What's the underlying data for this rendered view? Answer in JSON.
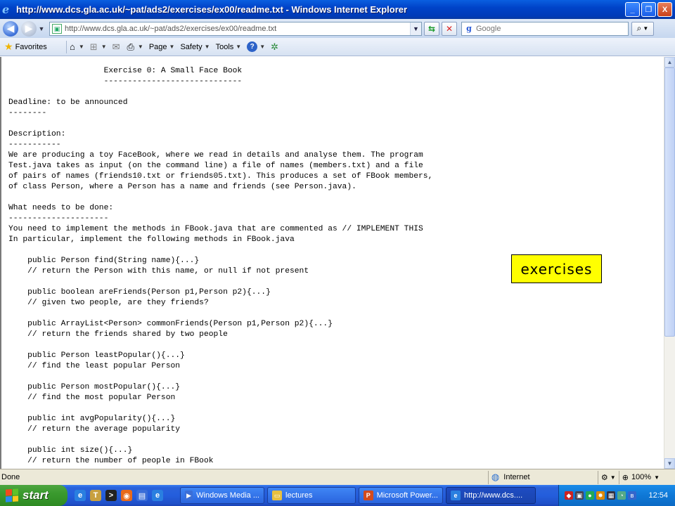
{
  "window": {
    "title": "http://www.dcs.gla.ac.uk/~pat/ads2/exercises/ex00/readme.txt - Windows Internet Explorer",
    "minimize": "_",
    "maximize": "❐",
    "close": "X"
  },
  "address_bar": {
    "url": "http://www.dcs.gla.ac.uk/~pat/ads2/exercises/ex00/readme.txt",
    "search_placeholder": "Google"
  },
  "command_bar": {
    "favorites": "Favorites",
    "page": "Page",
    "safety": "Safety",
    "tools": "Tools"
  },
  "document": {
    "lines": [
      "                    Exercise 0: A Small Face Book",
      "                    -----------------------------",
      "",
      "Deadline: to be announced",
      "--------",
      "",
      "Description:",
      "-----------",
      "We are producing a toy FaceBook, where we read in details and analyse them. The program",
      "Test.java takes as input (on the command line) a file of names (members.txt) and a file",
      "of pairs of names (friends10.txt or friends05.txt). This produces a set of FBook members,",
      "of class Person, where a Person has a name and friends (see Person.java).",
      "",
      "What needs to be done:",
      "---------------------",
      "You need to implement the methods in FBook.java that are commented as // IMPLEMENT THIS",
      "In particular, implement the following methods in FBook.java",
      "",
      "    public Person find(String name){...}",
      "    // return the Person with this name, or null if not present",
      "",
      "    public boolean areFriends(Person p1,Person p2){...}",
      "    // given two people, are they friends?",
      "",
      "    public ArrayList<Person> commonFriends(Person p1,Person p2){...}",
      "    // return the friends shared by two people",
      "",
      "    public Person leastPopular(){...}",
      "    // find the least popular Person",
      "",
      "    public Person mostPopular(){...}",
      "    // find the most popular Person",
      "",
      "    public int avgPopularity(){...}",
      "    // return the average popularity",
      "",
      "    public int size(){...}",
      "    // return the number of people in FBook"
    ]
  },
  "annotation": {
    "text": "exercises"
  },
  "status_bar": {
    "status": "Done",
    "zone": "Internet",
    "zoom": "100%"
  },
  "taskbar": {
    "start": "start",
    "buttons": [
      {
        "label": "Windows Media ...",
        "icon_color": "#3a6ed8"
      },
      {
        "label": "lectures",
        "icon_color": "#e8c040"
      },
      {
        "label": "Microsoft Power...",
        "icon_color": "#d24a1e"
      },
      {
        "label": "http://www.dcs....",
        "icon_color": "#2a7fe0"
      }
    ],
    "clock": "12:54"
  }
}
